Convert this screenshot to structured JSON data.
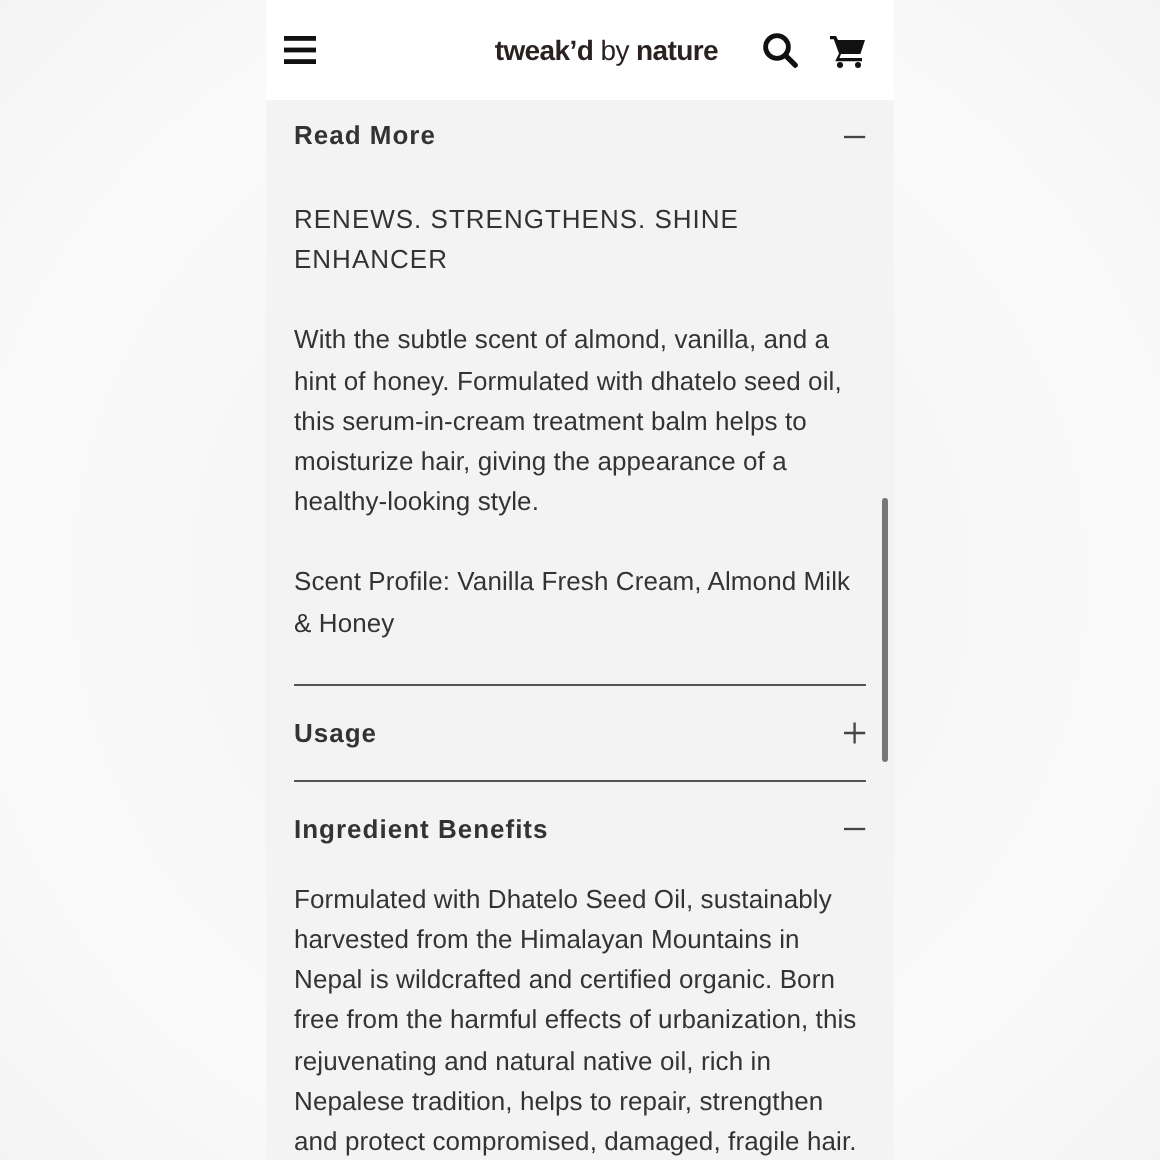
{
  "header": {
    "logo": "**tweak’d** by **nature**"
  },
  "sections": [
    {
      "title": "Read More",
      "expanded": true,
      "paragraphs": [
        "RENEWS. STRENGTHENS. SHINE ENHANCER",
        "With the subtle scent of almond, vanilla, and a hint of honey. Formulated with dhatelo seed oil, this serum-in-cream treatment balm helps to moisturize hair, giving the appearance of a healthy-looking style.",
        "Scent Profile: Vanilla Fresh Cream, Almond Milk & Honey"
      ]
    },
    {
      "title": "Usage",
      "expanded": false
    },
    {
      "title": "Ingredient Benefits",
      "expanded": true,
      "paragraphs": [
        "Formulated with Dhatelo Seed Oil, sustainably harvested from the Himalayan Mountains in Nepal is wildcrafted and certified organic. Born free from the harmful effects of urbanization, this rejuvenating and natural native oil, rich in Nepalese tradition, helps to repair, strengthen and protect compromised, damaged, fragile hair."
      ]
    }
  ]
}
